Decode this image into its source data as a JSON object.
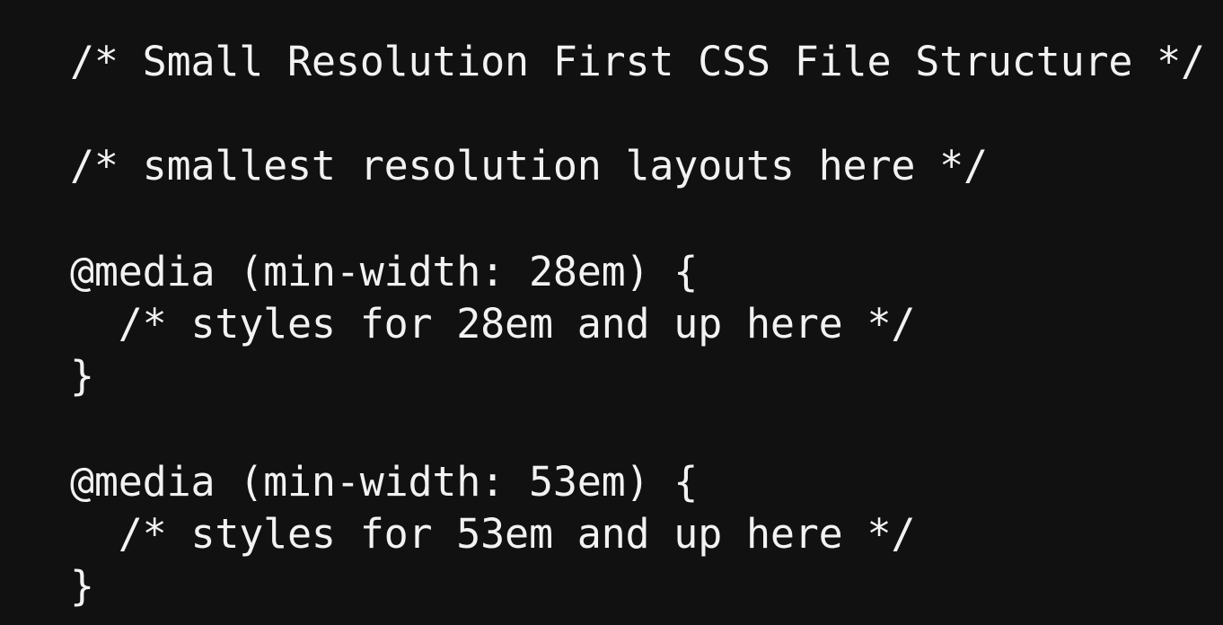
{
  "code": {
    "lines": [
      "/* Small Resolution First CSS File Structure */",
      "/* smallest resolution layouts here */",
      "@media (min-width: 28em) {",
      "  /* styles for 28em and up here */",
      "}",
      "@media (min-width: 53em) {",
      "  /* styles for 53em and up here */",
      "}"
    ]
  },
  "colors": {
    "background": "#111111",
    "text": "#f2f2f2"
  }
}
